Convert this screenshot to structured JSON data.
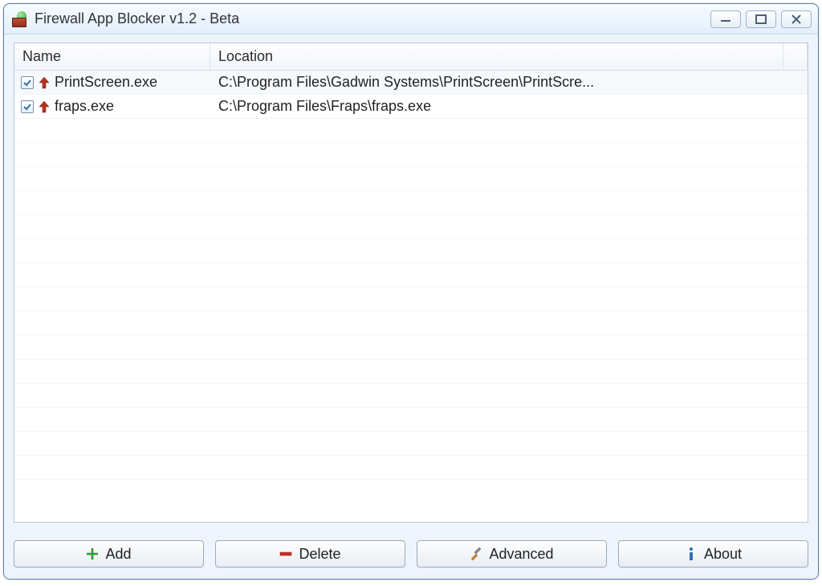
{
  "window": {
    "title": "Firewall App Blocker v1.2 - Beta"
  },
  "columns": {
    "name": "Name",
    "location": "Location"
  },
  "rows": [
    {
      "checked": true,
      "name": "PrintScreen.exe",
      "location": "C:\\Program Files\\Gadwin Systems\\PrintScreen\\PrintScre..."
    },
    {
      "checked": true,
      "name": "fraps.exe",
      "location": "C:\\Program Files\\Fraps\\fraps.exe"
    }
  ],
  "buttons": {
    "add": "Add",
    "delete": "Delete",
    "advanced": "Advanced",
    "about": "About"
  }
}
